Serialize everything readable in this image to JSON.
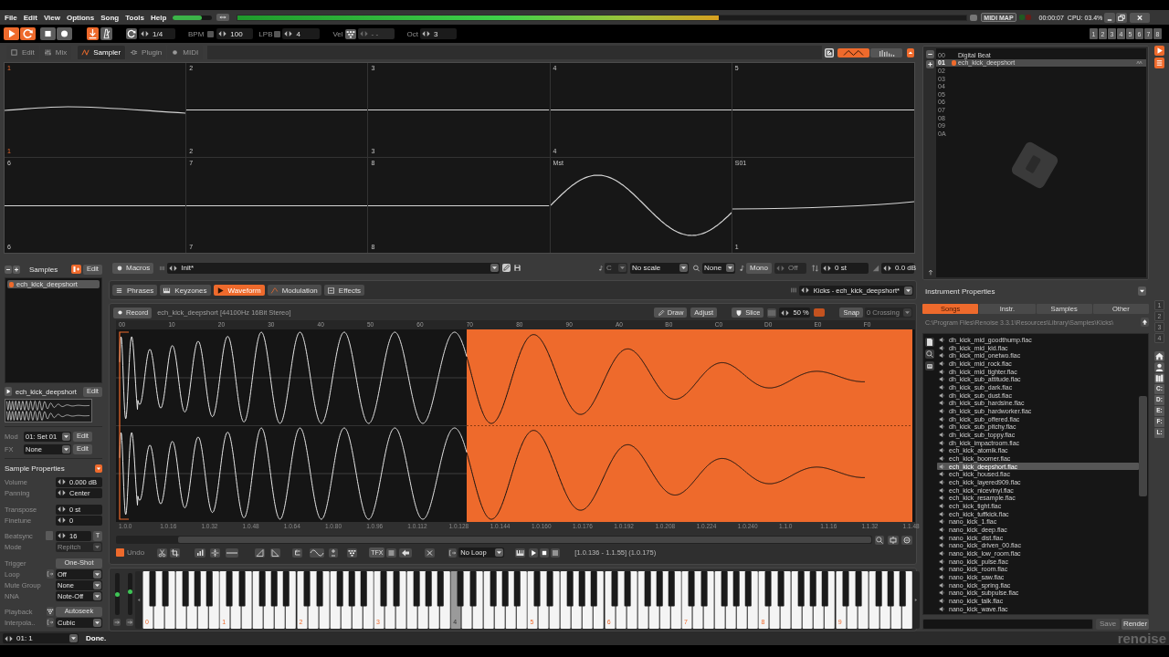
{
  "menu_bar": {
    "items": [
      "File",
      "Edit",
      "View",
      "Options",
      "Song",
      "Tools",
      "Help"
    ],
    "master_volume": {
      "level": 0.74
    },
    "peak_meter": {
      "level": 0.66
    },
    "midi_map": "MIDI MAP",
    "time": "00:00:07",
    "cpu": "CPU: 03.4%"
  },
  "transport": {
    "buttons": [
      {
        "kind": "play",
        "on": true
      },
      {
        "kind": "loop",
        "on": true
      },
      {
        "kind": "stop",
        "on": false
      },
      {
        "kind": "record",
        "on": false
      }
    ],
    "follow": {
      "on": true
    },
    "metronome": {
      "on": false
    },
    "block_length": "1/4",
    "bpm": {
      "label": "BPM",
      "value": "100",
      "checked": false
    },
    "lpb": {
      "label": "LPB",
      "value": "4",
      "checked": false
    },
    "velocity": {
      "label": "Vel",
      "value": "- -",
      "disabled": true
    },
    "octave": {
      "label": "Oct",
      "value": "3"
    },
    "track_buttons": [
      "1",
      "2",
      "3",
      "4",
      "5",
      "6",
      "7",
      "8"
    ]
  },
  "view_tabs": [
    {
      "label": "Edit",
      "selected": false
    },
    {
      "label": "Mix",
      "selected": false
    },
    {
      "label": "Sampler",
      "selected": true
    },
    {
      "label": "Plugin",
      "selected": false
    },
    {
      "label": "MIDI",
      "selected": false
    }
  ],
  "scope_modes": [
    {
      "kind": "waveform",
      "selected": true
    },
    {
      "kind": "spectrum",
      "selected": false
    }
  ],
  "scopes": [
    {
      "top_label": "1",
      "bottom_label": "1",
      "selected": true,
      "kind": "pulse"
    },
    {
      "top_label": "2",
      "bottom_label": "2",
      "selected": false,
      "kind": "flat"
    },
    {
      "top_label": "3",
      "bottom_label": "3",
      "selected": false,
      "kind": "flat"
    },
    {
      "top_label": "4",
      "bottom_label": "4",
      "selected": false,
      "kind": "flat"
    },
    {
      "top_label": "5",
      "selected": false,
      "kind": "flat"
    },
    {
      "top_label": "6",
      "bottom_label": "6",
      "selected": false,
      "kind": "flat"
    },
    {
      "top_label": "7",
      "bottom_label": "7",
      "selected": false,
      "kind": "flat"
    },
    {
      "top_label": "8",
      "bottom_label": "8",
      "selected": false,
      "kind": "flat"
    },
    {
      "top_label": "Mst",
      "selected": false,
      "kind": "wave"
    },
    {
      "top_label": "S01",
      "bottom_label": "1",
      "selected": false,
      "kind": "rise"
    }
  ],
  "instruments": [
    {
      "number": "00",
      "name": "Digital Beat",
      "selected": false
    },
    {
      "number": "01",
      "name": "ech_kick_deepshort",
      "selected": true
    },
    {
      "number": "02",
      "selected": false
    },
    {
      "number": "03",
      "selected": false
    },
    {
      "number": "04",
      "selected": false
    },
    {
      "number": "05",
      "selected": false
    },
    {
      "number": "06",
      "selected": false
    },
    {
      "number": "07",
      "selected": false
    },
    {
      "number": "08",
      "selected": false
    },
    {
      "number": "09",
      "selected": false
    },
    {
      "number": "0A",
      "selected": false
    }
  ],
  "instrument_properties": {
    "title": "Instrument Properties"
  },
  "browser": {
    "tabs": [
      {
        "label": "Songs",
        "selected": true
      },
      {
        "label": "Instr.",
        "selected": false
      },
      {
        "label": "Samples",
        "selected": false
      },
      {
        "label": "Other",
        "selected": false
      }
    ],
    "path": "C:\\Program Files\\Renoise 3.3.1\\Resources\\Library\\Samples\\Kicks\\",
    "files": [
      {
        "name": "dh_kick_mid_goodthump.flac",
        "selected": false
      },
      {
        "name": "dh_kick_mid_kid.flac",
        "selected": false
      },
      {
        "name": "dh_kick_mid_onetwo.flac",
        "selected": false
      },
      {
        "name": "dh_kick_mid_rock.flac",
        "selected": false
      },
      {
        "name": "dh_kick_mid_tighter.flac",
        "selected": false
      },
      {
        "name": "dh_kick_sub_attitude.flac",
        "selected": false
      },
      {
        "name": "dh_kick_sub_dark.flac",
        "selected": false
      },
      {
        "name": "dh_kick_sub_dust.flac",
        "selected": false
      },
      {
        "name": "dh_kick_sub_hardsine.flac",
        "selected": false
      },
      {
        "name": "dh_kick_sub_hardworker.flac",
        "selected": false
      },
      {
        "name": "dh_kick_sub_offered.flac",
        "selected": false
      },
      {
        "name": "dh_kick_sub_pitchy.flac",
        "selected": false
      },
      {
        "name": "dh_kick_sub_toppy.flac",
        "selected": false
      },
      {
        "name": "dh_kick_impactroom.flac",
        "selected": false
      },
      {
        "name": "ech_kick_atomik.flac",
        "selected": false
      },
      {
        "name": "ech_kick_boomer.flac",
        "selected": false
      },
      {
        "name": "ech_kick_deepshort.flac",
        "selected": true
      },
      {
        "name": "ech_kick_housed.flac",
        "selected": false
      },
      {
        "name": "ech_kick_layered909.flac",
        "selected": false
      },
      {
        "name": "ech_kick_nicevinyl.flac",
        "selected": false
      },
      {
        "name": "ech_kick_resample.flac",
        "selected": false
      },
      {
        "name": "ech_kick_tight.flac",
        "selected": false
      },
      {
        "name": "ech_kick_tuffkick.flac",
        "selected": false
      },
      {
        "name": "nano_kick_1.flac",
        "selected": false
      },
      {
        "name": "nano_kick_deep.flac",
        "selected": false
      },
      {
        "name": "nano_kick_dist.flac",
        "selected": false
      },
      {
        "name": "nano_kick_driven_00.flac",
        "selected": false
      },
      {
        "name": "nano_kick_low_room.flac",
        "selected": false
      },
      {
        "name": "nano_kick_pulse.flac",
        "selected": false
      },
      {
        "name": "nano_kick_room.flac",
        "selected": false
      },
      {
        "name": "nano_kick_saw.flac",
        "selected": false
      },
      {
        "name": "nano_kick_spring.flac",
        "selected": false
      },
      {
        "name": "nano_kick_subpulse.flac",
        "selected": false
      },
      {
        "name": "nano_kick_talk.flac",
        "selected": false
      },
      {
        "name": "nano_kick_wave.flac",
        "selected": false
      }
    ],
    "save": {
      "label": "Save",
      "disabled": true
    },
    "render": "Render",
    "slots": [
      {
        "label": "1",
        "disabled": true
      },
      {
        "label": "2",
        "disabled": true
      },
      {
        "label": "3",
        "disabled": true
      },
      {
        "label": "4",
        "disabled": true
      }
    ],
    "drives": [
      "C:",
      "D:",
      "E:",
      "F:",
      "L:"
    ]
  },
  "samples": {
    "title": "Samples",
    "edit": "Edit",
    "items": [
      {
        "name": "ech_kick_deepshort",
        "selected": true
      }
    ]
  },
  "sample_slot": {
    "name": "ech_kick_deepshort",
    "edit": "Edit"
  },
  "modulation_set": {
    "label": "Mod",
    "value": "01: Set 01",
    "edit": "Edit"
  },
  "effects_chain": {
    "label": "FX",
    "value": "None",
    "edit": "Edit"
  },
  "sample_properties": {
    "title": "Sample Properties",
    "groups": [
      [
        {
          "kind": "spin",
          "label": "Volume",
          "value": "0.000 dB",
          "disabled": false
        },
        {
          "kind": "spin",
          "label": "Panning",
          "value": "Center",
          "disabled": false
        }
      ],
      [
        {
          "kind": "spin",
          "label": "Transpose",
          "value": "0 st",
          "disabled": false
        },
        {
          "kind": "spin",
          "label": "Finetune",
          "value": "0",
          "disabled": false
        }
      ],
      [
        {
          "kind": "sync",
          "label": "Beatsync",
          "value": "16",
          "checked": false,
          "mode": "T",
          "disabled": false
        },
        {
          "kind": "select",
          "label": "Mode",
          "value": "Repitch",
          "disabled": true
        }
      ],
      [
        {
          "kind": "button",
          "label": "Trigger",
          "value": "One-Shot",
          "disabled": false
        },
        {
          "kind": "icon_select",
          "label": "Loop",
          "value": "Off",
          "disabled": false
        },
        {
          "kind": "select",
          "label": "Mute Group",
          "value": "None",
          "disabled": false
        },
        {
          "kind": "select",
          "label": "NNA",
          "value": "Note-Off",
          "disabled": false
        }
      ],
      [
        {
          "kind": "icon_button",
          "label": "Playback",
          "value": "Autoseek",
          "disabled": false
        },
        {
          "kind": "icon_select",
          "label": "Interpola..",
          "value": "Cubic",
          "disabled": false
        }
      ]
    ]
  },
  "instrument_bar": {
    "macros": "Macros",
    "preset": "Init*",
    "note": {
      "value": "C",
      "disabled": true
    },
    "scale": "No scale",
    "key_mode": "None",
    "mono": "Mono",
    "glide": {
      "value": "Off",
      "disabled": true
    },
    "transpose": "0 st",
    "volume": "0.0 dB"
  },
  "editor_tabs": [
    {
      "label": "Phrases",
      "selected": false
    },
    {
      "label": "Keyzones",
      "selected": false
    },
    {
      "label": "Waveform",
      "selected": true
    },
    {
      "label": "Modulation",
      "selected": false
    },
    {
      "label": "Effects",
      "selected": false
    }
  ],
  "sample_selector": "Kicks - ech_kick_deepshort*",
  "waveform_editor": {
    "record": "Record",
    "info": "ech_kick_deepshort [44100Hz 16Bit Stereo]",
    "draw": "Draw",
    "adjust": "Adjust",
    "slice": "Slice",
    "zoom": "50 %",
    "snap": "Snap",
    "snap_mode": {
      "value": "0 Crossing",
      "disabled": true
    },
    "ruler": [
      "00",
      "10",
      "20",
      "30",
      "40",
      "50",
      "60",
      "70",
      "80",
      "90",
      "A0",
      "B0",
      "C0",
      "D0",
      "E0",
      "F0"
    ],
    "positions": [
      "1.0.0",
      "1.0.16",
      "1.0.32",
      "1.0.48",
      "1.0.64",
      "1.0.80",
      "1.0.96",
      "1.0.112",
      "1.0.128",
      "1.0.144",
      "1.0.160",
      "1.0.176",
      "1.0.192",
      "1.0.208",
      "1.0.224",
      "1.0.240",
      "1.1.0",
      "1.1.16",
      "1.1.32",
      "1.1.48"
    ]
  },
  "sample_toolbar": {
    "undo": {
      "label": "Undo",
      "checked": true
    },
    "fx_button": "TFX",
    "loop_mode": "No Loop",
    "range": "[1.0.136 - 1.1.55] (1.0.175)"
  },
  "keyboard": {
    "octaves": [
      {
        "label": "0",
        "selected": false
      },
      {
        "label": "1",
        "selected": false
      },
      {
        "label": "2",
        "selected": false
      },
      {
        "label": "3",
        "selected": false
      },
      {
        "label": "4",
        "selected": true
      },
      {
        "label": "5",
        "selected": false
      },
      {
        "label": "6",
        "selected": false
      },
      {
        "label": "7",
        "selected": false
      },
      {
        "label": "8",
        "selected": false
      },
      {
        "label": "9",
        "selected": false
      }
    ],
    "sliders": [
      {
        "level": 0.48
      },
      {
        "level": 0.55
      }
    ]
  },
  "status_bar": {
    "pattern": "01: 1",
    "message": "Done.",
    "logo": "renoise"
  }
}
